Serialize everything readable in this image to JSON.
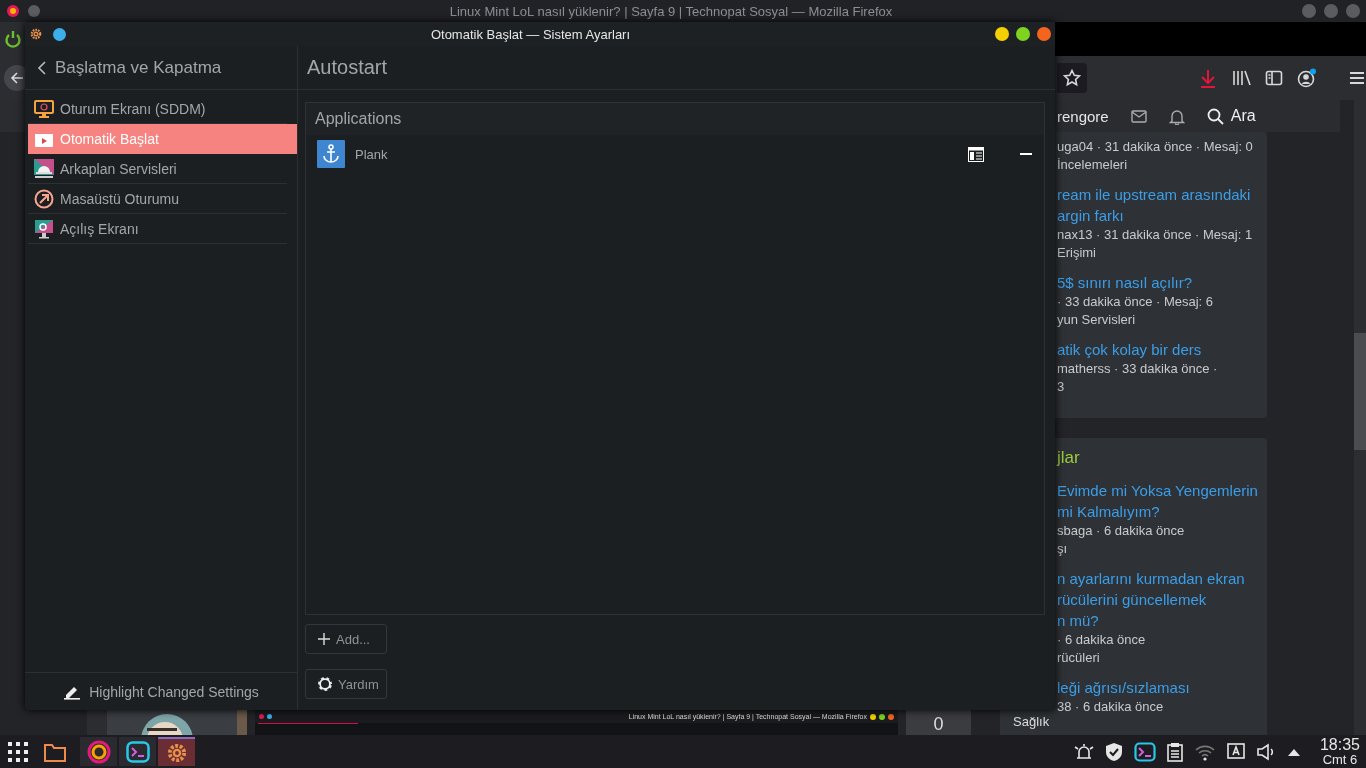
{
  "browser": {
    "title": "Linux Mint LoL nasıl yüklenir? | Sayfa 9 | Technopat Sosyal — Mozilla Firefox",
    "nav": {
      "user": "rengore",
      "search": "Ara"
    },
    "cards": [
      {
        "threads": [
          {
            "meta": "uga04 · 31 dakika önce · Mesaj: 0",
            "forum": "İncelemeleri"
          },
          {
            "title_lines": [
              "ream ile upstream arasındaki",
              "argin farkı"
            ],
            "meta": "nax13 · 31 dakika önce · Mesaj: 1",
            "forum": "Erişimi"
          },
          {
            "title_lines": [
              "5$ sınırı nasıl açılır?"
            ],
            "meta": "· 33 dakika önce · Mesaj: 6",
            "forum": "yun Servisleri"
          },
          {
            "title_lines": [
              "atik çok kolay bir ders"
            ],
            "meta": "matherss · 33 dakika önce ·",
            "forum": "3"
          }
        ]
      },
      {
        "heading": "jlar",
        "threads": [
          {
            "title_lines": [
              "Evimde mi Yoksa Yengemlerin",
              "mi Kalmalıyım?"
            ],
            "meta": "sbaga · 6 dakika önce",
            "forum": "şı"
          },
          {
            "title_lines": [
              "n ayarlarını kurmadan ekran",
              "rücülerini güncellemek",
              "n mü?"
            ],
            "meta": "· 6 dakika önce",
            "forum": "rücüleri"
          },
          {
            "title_lines": [
              "leği ağrısı/sızlaması"
            ],
            "meta": "38 · 6 dakika önce"
          }
        ]
      }
    ],
    "preview_title": "Linux Mint LoL nasıl yüklenir? | Sayfa 9 | Technopat Sosyal — Mozilla Firefox",
    "count": "0",
    "category": "Sağlık"
  },
  "settings": {
    "title": "Otomatik Başlat — Sistem Ayarları",
    "back_label": "Başlatma ve Kapatma",
    "items": [
      {
        "label": "Oturum Ekranı (SDDM)",
        "selected": false
      },
      {
        "label": "Otomatik Başlat",
        "selected": true
      },
      {
        "label": "Arkaplan Servisleri",
        "selected": false
      },
      {
        "label": "Masaüstü Oturumu",
        "selected": false
      },
      {
        "label": "Açılış Ekranı",
        "selected": false
      }
    ],
    "highlight_button": "Highlight Changed Settings",
    "page_title": "Autostart",
    "section": "Applications",
    "apps": [
      {
        "name": "Plank"
      }
    ],
    "add_button": "Add...",
    "help_button": "Yardım"
  },
  "taskbar": {
    "tasks": [
      {
        "kind": "browser",
        "active": false
      },
      {
        "kind": "terminal",
        "active": false
      },
      {
        "kind": "settings",
        "active": true
      }
    ],
    "time": "18:35",
    "date": "Cmt 6"
  }
}
